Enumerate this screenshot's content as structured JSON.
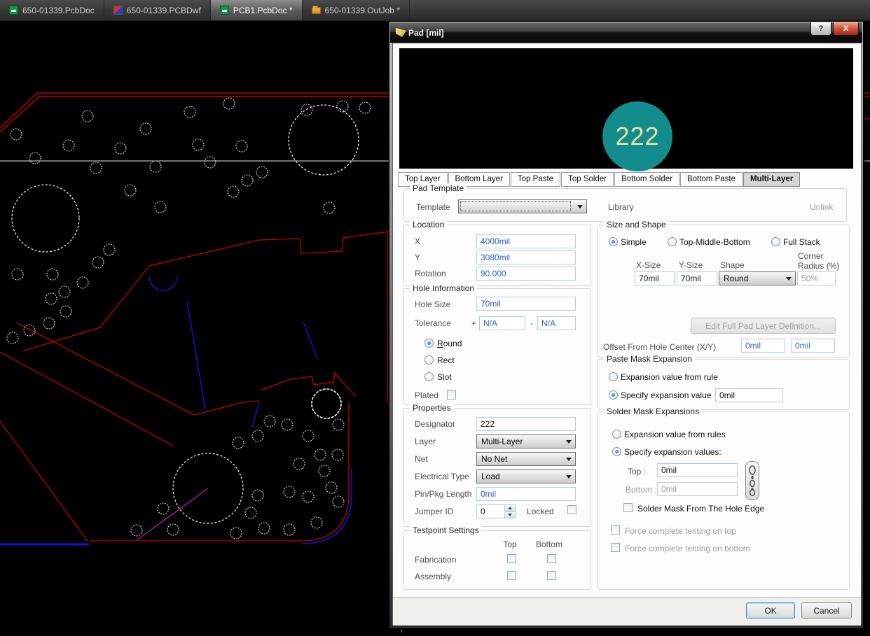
{
  "window": {
    "document_tabs": [
      {
        "label": "650-01339.PcbDoc",
        "active": false
      },
      {
        "label": "650-01339.PCBDwf",
        "active": false
      },
      {
        "label": "PCB1.PcbDoc *",
        "active": true
      },
      {
        "label": "650-01339.OutJob *",
        "active": false
      }
    ]
  },
  "dialog": {
    "title": "Pad [mil]",
    "help": "?",
    "close": "X",
    "preview": {
      "designator": "222"
    },
    "layer_tabs": [
      {
        "label": "Top Layer"
      },
      {
        "label": "Bottom Layer"
      },
      {
        "label": "Top Paste"
      },
      {
        "label": "Top Solder"
      },
      {
        "label": "Bottom Solder"
      },
      {
        "label": "Bottom Paste"
      },
      {
        "label": "Multi-Layer"
      }
    ],
    "pad_template": {
      "caption": "Pad Template",
      "template_label": "Template",
      "library_label": "Library",
      "unlink": "Unlink"
    },
    "location": {
      "caption": "Location",
      "x_label": "X",
      "x_value": "4000mil",
      "y_label": "Y",
      "y_value": "3080mil",
      "rotation_label": "Rotation",
      "rotation_value": "90.000"
    },
    "hole": {
      "caption": "Hole Information",
      "size_label": "Hole Size",
      "size_value": "70mil",
      "tolerance_label": "Tolerance",
      "plus": "+",
      "minus": "-",
      "tol_plus": "N/A",
      "tol_minus": "N/A",
      "round": "Round",
      "rect": "Rect",
      "slot": "Slot",
      "plated": "Plated"
    },
    "properties": {
      "caption": "Properties",
      "designator_label": "Designator",
      "designator_value": "222",
      "layer_label": "Layer",
      "layer_value": "Multi-Layer",
      "net_label": "Net",
      "net_value": "No Net",
      "etype_label": "Electrical Type",
      "etype_value": "Load",
      "pin_label": "Pin/Pkg Length",
      "pin_value": "0mil",
      "jumper_label": "Jumper ID",
      "jumper_value": "0",
      "locked_label": "Locked"
    },
    "testpoint": {
      "caption": "Testpoint Settings",
      "top": "Top",
      "bottom": "Bottom",
      "fabrication": "Fabrication",
      "assembly": "Assembly"
    },
    "size_shape": {
      "caption": "Size and Shape",
      "simple": "Simple",
      "tmb": "Top-Middle-Bottom",
      "full": "Full Stack",
      "xsize_label": "X-Size",
      "ysize_label": "Y-Size",
      "shape_label": "Shape",
      "corner_label_1": "Corner",
      "corner_label_2": "Radius (%)",
      "xsize": "70mil",
      "ysize": "70mil",
      "shape": "Round",
      "corner": "50%",
      "edit_button": "Edit Full Pad Layer Definition...",
      "offset_label": "Offset From Hole Center (X/Y)",
      "offset_x": "0mil",
      "offset_y": "0mil"
    },
    "paste_mask": {
      "caption": "Paste Mask Expansion",
      "from_rule": "Expansion value from rule",
      "specify": "Specify expansion value",
      "value": "0mil"
    },
    "solder_mask": {
      "caption": "Solder Mask Expansions",
      "from_rules": "Expansion value from rules",
      "specify": "Specify expansion values:",
      "top_label": "Top :",
      "top_value": "0mil",
      "bottom_label": "Bottom :",
      "bottom_value": "0mil",
      "hole_edge": "Solder Mask From The Hole Edge",
      "tent_top": "Force complete tenting on top",
      "tent_bottom": "Force complete tenting on bottom"
    },
    "footer": {
      "ok": "OK",
      "cancel": "Cancel"
    }
  },
  "colors": {
    "pad_teal": "#128C8C",
    "pad_text": "#E8E0A0",
    "value_blue": "#2A62CC",
    "trace_red": "#C40000",
    "trace_blue": "#1414D4",
    "outline_white": "#FFFFFF"
  }
}
